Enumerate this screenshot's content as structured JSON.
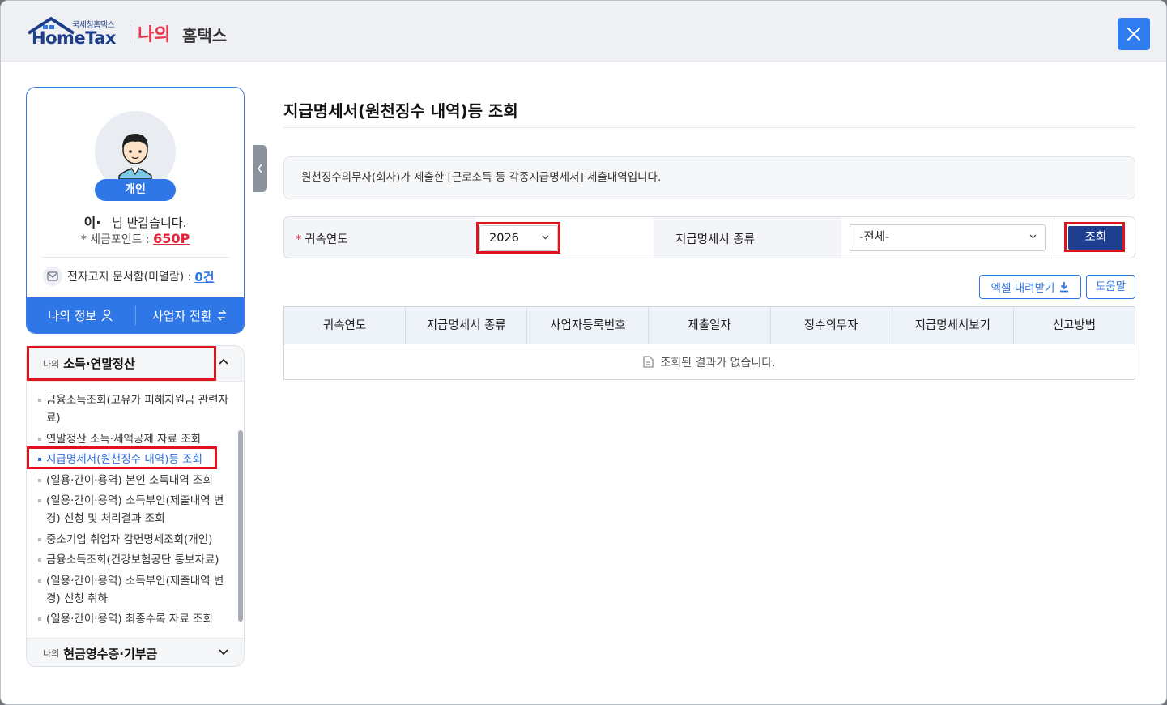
{
  "header": {
    "logo_small": "국세청홈택스",
    "logo_main": "HomeTax",
    "my_label": "나의",
    "hometax_label": "홈택스",
    "close_icon": "close-icon"
  },
  "profile": {
    "badge": "개인",
    "name_initial": "이·",
    "greeting_suffix": "님 반갑습니다.",
    "points_label": "* 세금포인트 :",
    "points_value": "650P",
    "docbox_label": "전자고지 문서함(미열람) :",
    "docbox_count": "0건",
    "my_info_button": "나의 정보",
    "business_switch_button": "사업자 전환"
  },
  "menu": {
    "section_small": "나의",
    "section_title": "소득·연말정산",
    "items": [
      "금융소득조회(고유가 피해지원금 관련자료)",
      "연말정산 소득·세액공제 자료 조회",
      "지급명세서(원천징수 내역)등 조회",
      "(일용·간이·용역) 본인 소득내역 조회",
      "(일용·간이·용역) 소득부인(제출내역 변경) 신청 및 처리결과 조회",
      "중소기업 취업자 감면명세조회(개인)",
      "금융소득조회(건강보험공단 통보자료)",
      "(일용·간이·용역) 소득부인(제출내역 변경) 신청 취하",
      "(일용·간이·용역) 최종수록 자료 조회"
    ],
    "footer_small": "나의",
    "footer_title": "현금영수증·기부금"
  },
  "main": {
    "title": "지급명세서(원천징수 내역)등 조회",
    "info": "원천징수의무자(회사)가 제출한 [근로소득 등 각종지급명세서] 제출내역입니다.",
    "year_label": "귀속연도",
    "year_required": "*",
    "year_value": "2026",
    "type_label": "지급명세서 종류",
    "type_value": "-전체-",
    "search_button": "조회",
    "excel_button": "엑셀 내려받기",
    "help_button": "도움말",
    "columns": [
      "귀속연도",
      "지급명세서 종류",
      "사업자등록번호",
      "제출일자",
      "징수의무자",
      "지급명세서보기",
      "신고방법"
    ],
    "empty_message": "조회된 결과가 없습니다."
  },
  "colors": {
    "accent": "#2f76e6",
    "navy_button": "#1e3f8f",
    "highlight_outline": "#e0121e",
    "points": "#e0243a"
  }
}
